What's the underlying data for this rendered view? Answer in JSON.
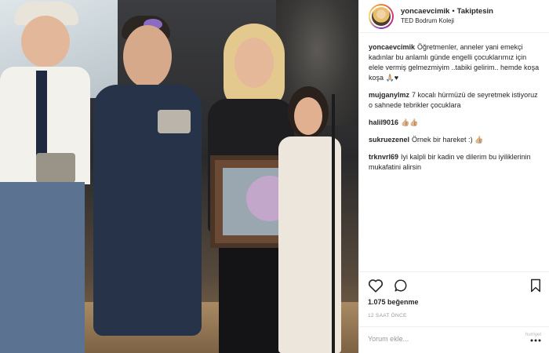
{
  "post": {
    "image_alt": "Ödül töreninde sahnede çocuklar ve Yonca Evcimik",
    "header": {
      "username": "yoncaevcimik",
      "separator": "•",
      "follow_label": "Takiptesin",
      "location": "TED Bodrum Koleji",
      "avatar_icon": "profile-avatar"
    },
    "comments": [
      {
        "user": "yoncaevcimik",
        "text": "Öğretmenler, anneler yani emekçi kadınlar bu anlamlı günde engelli çocuklarımız için elele vermiş gelmezmiyim ..tabiki gelirim.. hemde koşa koşa 🙏🏼♥"
      },
      {
        "user": "mujganylmz",
        "text": "7 kocalı hürmüzü de seyretmek istiyoruz o sahnede tebrikler çocuklara"
      },
      {
        "user": "halil9016",
        "text": "👍🏼👍🏼"
      },
      {
        "user": "sukruezenel",
        "text": "Örnek bir hareket :) 👍🏼"
      },
      {
        "user": "trknvrl69",
        "text": "Iyi kalpli bir kadin ve dilerim bu iyiliklerinin mukafatini alirsin"
      }
    ],
    "actions": {
      "like_icon": "heart-outline",
      "comment_icon": "speech-bubble",
      "save_icon": "bookmark"
    },
    "likes": "1.075 beğenme",
    "time_ago": "12 SAAT ÖNCE",
    "comment_box": {
      "placeholder": "Yorum ekle...",
      "more_icon": "ellipsis"
    },
    "watermark": "hurriyet"
  }
}
